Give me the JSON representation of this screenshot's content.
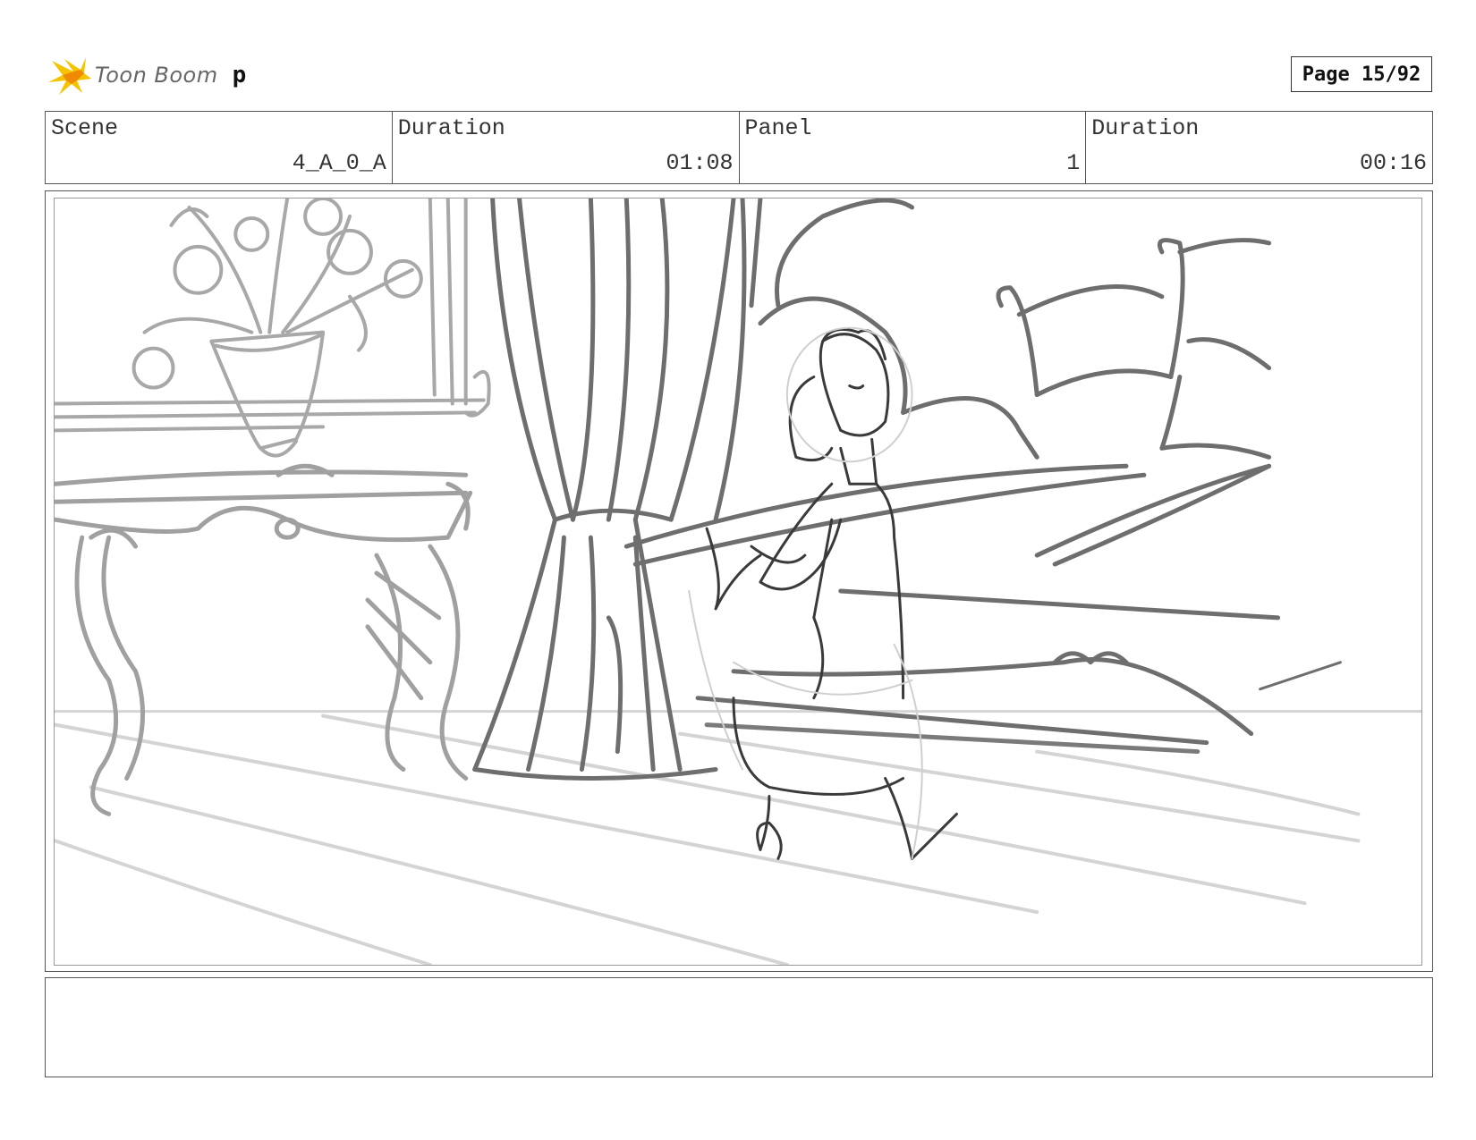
{
  "header": {
    "logo_text": "Toon Boom",
    "project_code": "p",
    "page_label": "Page 15/92"
  },
  "info": {
    "scene_label": "Scene",
    "scene_value": "4_A_0_A",
    "duration1_label": "Duration",
    "duration1_value": "01:08",
    "panel_label": "Panel",
    "panel_value": "1",
    "duration2_label": "Duration",
    "duration2_value": "00:16"
  },
  "notes": {
    "text": ""
  },
  "colors": {
    "logo_yellow": "#f5c400",
    "logo_orange": "#f08a00",
    "sketch_dark": "#3a3a3a",
    "sketch_mid": "#6e6e6e",
    "sketch_light": "#a8a8a8",
    "sketch_faint": "#cfcfcf"
  }
}
